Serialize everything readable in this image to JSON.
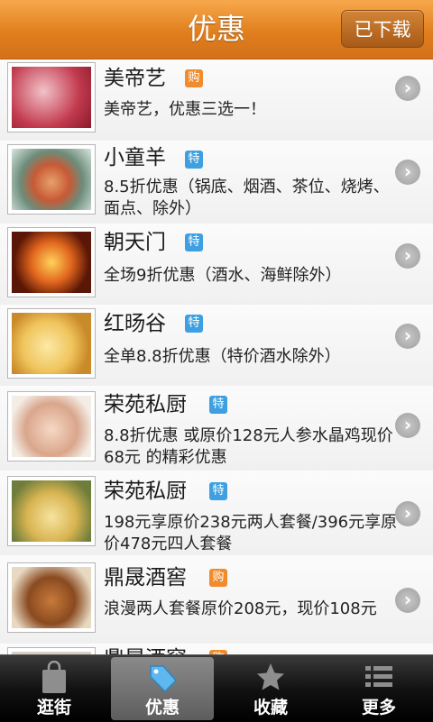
{
  "header": {
    "title": "优惠",
    "download_label": "已下载"
  },
  "deals": [
    {
      "name": "美帝艺",
      "badge": "购",
      "badge_type": "gou",
      "desc": "美帝艺，优惠三选一！",
      "image": "nails-photo"
    },
    {
      "name": "小童羊",
      "badge": "特",
      "badge_type": "te",
      "desc": "8.5折优惠（锅底、烟酒、茶位、烧烤、面点、除外）",
      "image": "hotpot-photo"
    },
    {
      "name": "朝天门",
      "badge": "特",
      "badge_type": "te",
      "desc": "全场9折优惠（酒水、海鲜除外）",
      "image": "fire-dish-photo"
    },
    {
      "name": "红旸谷",
      "badge": "特",
      "badge_type": "te",
      "desc": "全单8.8折优惠（特价酒水除外）",
      "image": "dessert-photo"
    },
    {
      "name": "荣苑私厨",
      "badge": "特",
      "badge_type": "te",
      "desc": "8.8折优惠 或原价128元人参水晶鸡现价68元 的精彩优惠",
      "image": "massage-photo"
    },
    {
      "name": "荣苑私厨",
      "badge": "特",
      "badge_type": "te",
      "desc": "198元享原价238元两人套餐/396元享原价478元四人套餐",
      "image": "fries-photo"
    },
    {
      "name": "鼎晟酒窖",
      "badge": "购",
      "badge_type": "gou",
      "desc": "浪漫两人套餐原价208元，现价108元",
      "image": "lamb-chops-photo"
    },
    {
      "name": "鼎晟酒窖",
      "badge": "购",
      "badge_type": "gou",
      "desc": "",
      "image": "partial-photo"
    }
  ],
  "tabs": [
    {
      "label": "逛街",
      "icon": "shopping-bag-icon",
      "active": false
    },
    {
      "label": "优惠",
      "icon": "tag-icon",
      "active": true
    },
    {
      "label": "收藏",
      "icon": "star-icon",
      "active": false
    },
    {
      "label": "更多",
      "icon": "list-icon",
      "active": false
    }
  ],
  "colors": {
    "header": "#e3861f",
    "badge_gou": "#f08c2e",
    "badge_te": "#3ea0e0"
  }
}
